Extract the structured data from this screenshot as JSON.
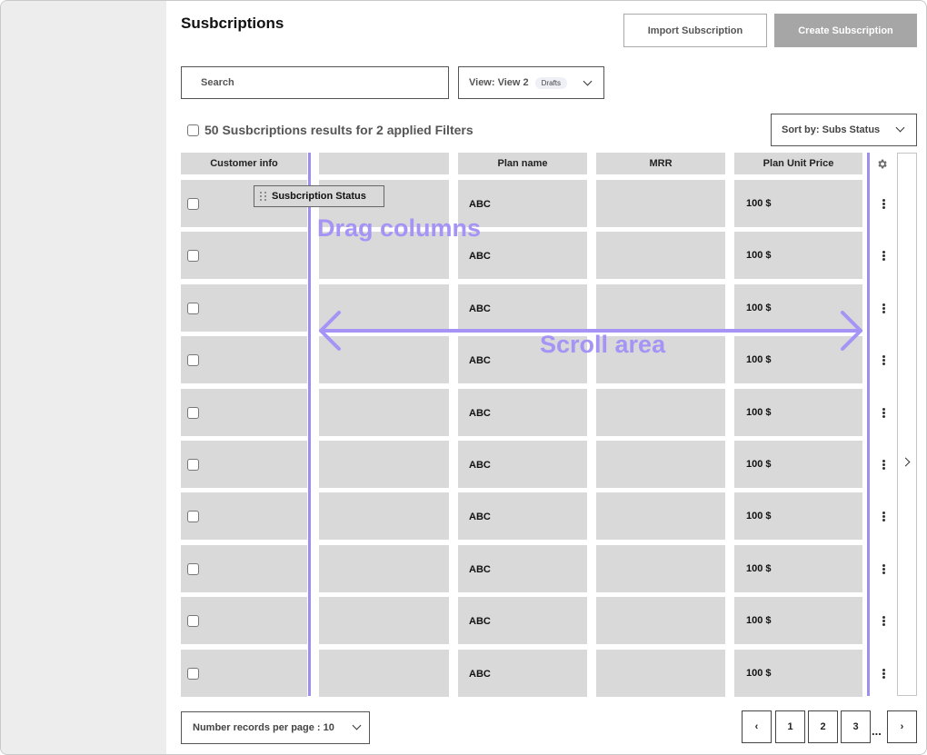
{
  "header": {
    "title": "Susbcriptions",
    "import_label": "Import Subscription",
    "create_label": "Create Subscription"
  },
  "toolbar": {
    "search_placeholder": "Search",
    "view_label": "View: View 2",
    "view_badge": "Drafts",
    "results_text": "50 Susbcriptions results for 2 applied Filters",
    "sort_label": "Sort by: Subs Status"
  },
  "table": {
    "columns": [
      "Customer info",
      "",
      "Plan name",
      "MRR",
      "Plan Unit Price"
    ],
    "rows": [
      {
        "plan": "ABC",
        "price": "100 $"
      },
      {
        "plan": "ABC",
        "price": "100 $"
      },
      {
        "plan": "ABC",
        "price": "100 $"
      },
      {
        "plan": "ABC",
        "price": "100 $"
      },
      {
        "plan": "ABC",
        "price": "100 $"
      },
      {
        "plan": "ABC",
        "price": "100 $"
      },
      {
        "plan": "ABC",
        "price": "100 $"
      },
      {
        "plan": "ABC",
        "price": "100 $"
      },
      {
        "plan": "ABC",
        "price": "100 $"
      },
      {
        "plan": "ABC",
        "price": "100 $"
      }
    ],
    "drag_chip_label": "Susbcription Status"
  },
  "annotations": {
    "drag_columns": "Drag columns",
    "scroll_area": "Scroll area",
    "accent_color": "#9d8ef0"
  },
  "footer": {
    "per_page_label": "Number records per page : 10",
    "pages": [
      "1",
      "2",
      "3"
    ],
    "prev": "‹",
    "next": "›",
    "ellipsis": "..."
  },
  "icons": [
    "gear-icon",
    "chevron-down-icon",
    "chevron-right-icon",
    "kebab-menu-icon",
    "drag-grip-icon"
  ]
}
